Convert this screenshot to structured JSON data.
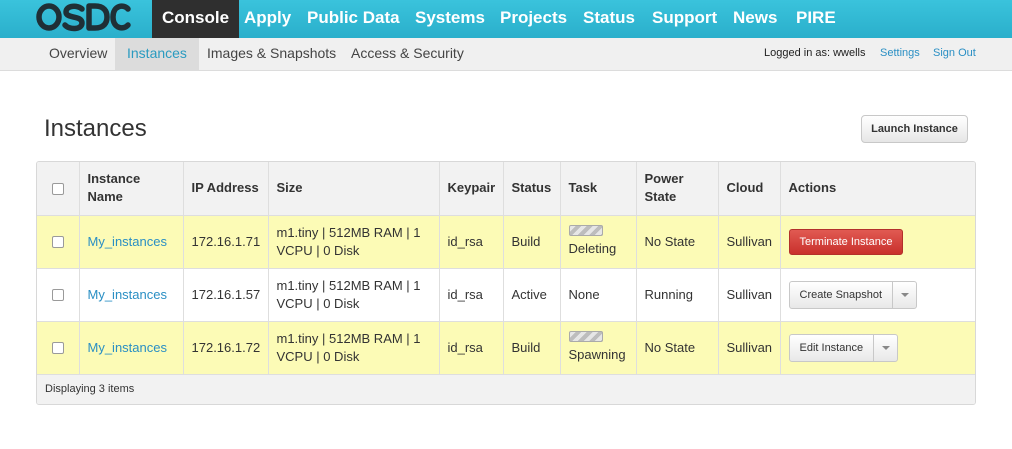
{
  "brand": {
    "logo_text": "OSDC",
    "accent": "#2aafcb",
    "nav_active_bg": "#2f2f2f"
  },
  "topnav": {
    "items": [
      {
        "label": "Console",
        "active": true
      },
      {
        "label": "Apply"
      },
      {
        "label": "Public Data"
      },
      {
        "label": "Systems"
      },
      {
        "label": "Projects"
      },
      {
        "label": "Status"
      },
      {
        "label": "Support"
      },
      {
        "label": "News"
      },
      {
        "label": "PIRE"
      }
    ]
  },
  "subnav": {
    "items": [
      {
        "label": "Overview"
      },
      {
        "label": "Instances",
        "active": true
      },
      {
        "label": "Images & Snapshots"
      },
      {
        "label": "Access & Security"
      }
    ],
    "logged_in_text": "Logged in as: wwells",
    "settings_label": "Settings",
    "signout_label": "Sign Out"
  },
  "page": {
    "title": "Instances",
    "launch_button": "Launch Instance"
  },
  "table": {
    "headers": [
      "Instance Name",
      "IP Address",
      "Size",
      "Keypair",
      "Status",
      "Task",
      "Power State",
      "Cloud",
      "Actions"
    ],
    "rows": [
      {
        "name": "My_instances",
        "ip": "172.16.1.71",
        "size": "m1.tiny | 512MB RAM | 1 VCPU | 0 Disk",
        "keypair": "id_rsa",
        "status": "Build",
        "task": "Deleting",
        "power": "No State",
        "cloud": "Sullivan",
        "action": "Terminate Instance"
      },
      {
        "name": "My_instances",
        "ip": "172.16.1.57",
        "size": "m1.tiny | 512MB RAM | 1 VCPU | 0 Disk",
        "keypair": "id_rsa",
        "status": "Active",
        "task": "None",
        "power": "Running",
        "cloud": "Sullivan",
        "action": "Create Snapshot"
      },
      {
        "name": "My_instances",
        "ip": "172.16.1.72",
        "size": "m1.tiny | 512MB RAM | 1 VCPU | 0 Disk",
        "keypair": "id_rsa",
        "status": "Build",
        "task": "Spawning",
        "power": "No State",
        "cloud": "Sullivan",
        "action": "Edit Instance"
      }
    ],
    "footer": "Displaying 3 items"
  }
}
